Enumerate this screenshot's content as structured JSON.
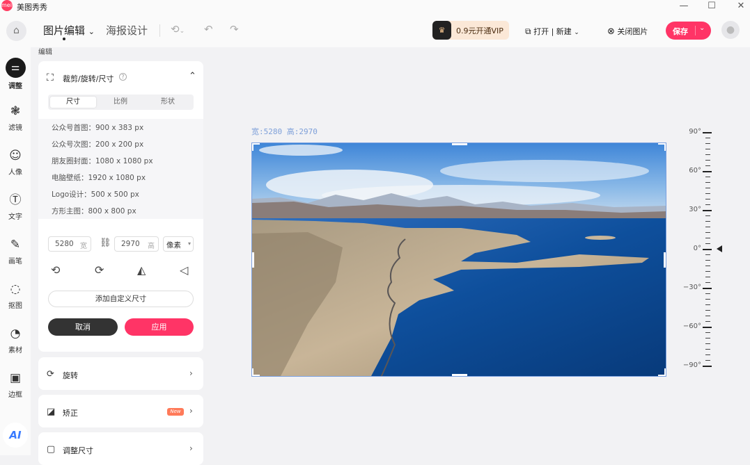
{
  "app": {
    "name": "美图秀秀",
    "logo_text": "meitu"
  },
  "window_controls": {
    "minimize": "—",
    "maximize": "☐",
    "close": "✕"
  },
  "toolbar": {
    "tab_edit": "图片编辑",
    "tab_edit_caret": "⌄",
    "tab_poster": "海报设计",
    "vip_text": "0.9元开通VIP",
    "open_new": "打开 | 新建",
    "close_image": "关闭图片",
    "save": "保存"
  },
  "sidebar": {
    "items": [
      {
        "label": "调整",
        "icon": "sliders-icon"
      },
      {
        "label": "滤镜",
        "icon": "filter-icon"
      },
      {
        "label": "人像",
        "icon": "portrait-icon"
      },
      {
        "label": "文字",
        "icon": "text-icon"
      },
      {
        "label": "画笔",
        "icon": "brush-icon"
      },
      {
        "label": "抠图",
        "icon": "cutout-icon"
      },
      {
        "label": "素材",
        "icon": "sticker-icon"
      },
      {
        "label": "边框",
        "icon": "frame-icon"
      }
    ],
    "ai_label": "AI"
  },
  "panel": {
    "heading": "编辑",
    "crop": {
      "title": "裁剪/旋转/尺寸",
      "tabs": [
        "尺寸",
        "比例",
        "形状"
      ],
      "presets": [
        "公众号首图：900 x 383 px",
        "公众号次图：200 x 200 px",
        "朋友圈封面：1080 x 1080 px",
        "电脑壁纸：1920 x 1080 px",
        "Logo设计：500 x 500 px",
        "方形主图：800 x 800 px"
      ],
      "width_value": "5280",
      "width_unit": "宽",
      "height_value": "2970",
      "height_unit": "高",
      "unit": "像素",
      "add_custom": "添加自定义尺寸",
      "cancel": "取消",
      "apply": "应用"
    },
    "rotate_label": "旋转",
    "correct_label": "矫正",
    "new_badge": "New",
    "resize_label": "调整尺寸"
  },
  "canvas": {
    "dims_label": "宽:5280 高:2970"
  },
  "ruler": {
    "labels": [
      "90°",
      "60°",
      "30°",
      "0°",
      "−30°",
      "−60°",
      "−90°"
    ],
    "current": 0
  }
}
